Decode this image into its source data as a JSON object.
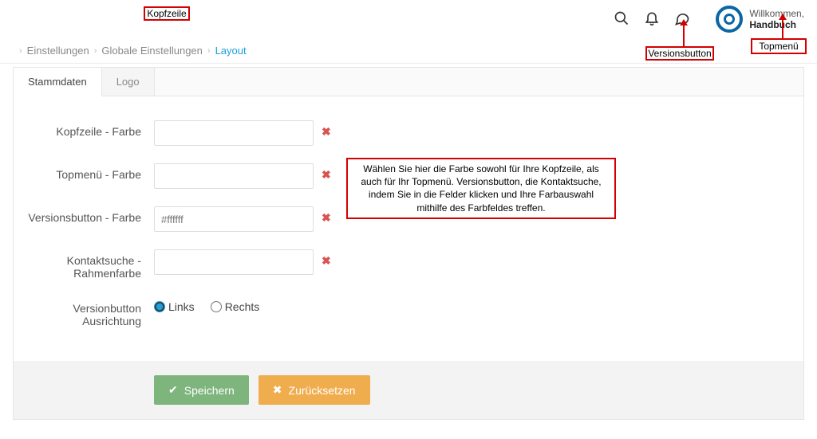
{
  "header": {
    "welcome_label": "Willkommen,",
    "username": "Handbuch"
  },
  "breadcrumb": {
    "item1": "Einstellungen",
    "item2": "Globale Einstellungen",
    "item3": "Layout"
  },
  "tabs": {
    "tab1": "Stammdaten",
    "tab2": "Logo"
  },
  "form": {
    "row1_label": "Kopfzeile - Farbe",
    "row1_value": "",
    "row2_label": "Topmenü - Farbe",
    "row2_value": "",
    "row3_label": "Versionsbutton - Farbe",
    "row3_placeholder": "#ffffff",
    "row3_value": "",
    "row4_label": "Kontaktsuche - Rahmenfarbe",
    "row4_value": "",
    "row5_label": "Versionbutton Ausrichtung",
    "row5_opt_links": "Links",
    "row5_opt_rechts": "Rechts"
  },
  "buttons": {
    "save": "Speichern",
    "reset": "Zurücksetzen"
  },
  "annotations": {
    "kopfzeile": "Kopfzeile",
    "versionsbutton": "Versionsbutton",
    "topmenu": "Topmenü",
    "note": "Wählen Sie hier die Farbe sowohl für Ihre Kopfzeile, als auch für Ihr Topmenü. Versionsbutton, die Kontaktsuche, indem Sie in die Felder klicken und Ihre Farbauswahl mithilfe des Farbfeldes treffen."
  }
}
